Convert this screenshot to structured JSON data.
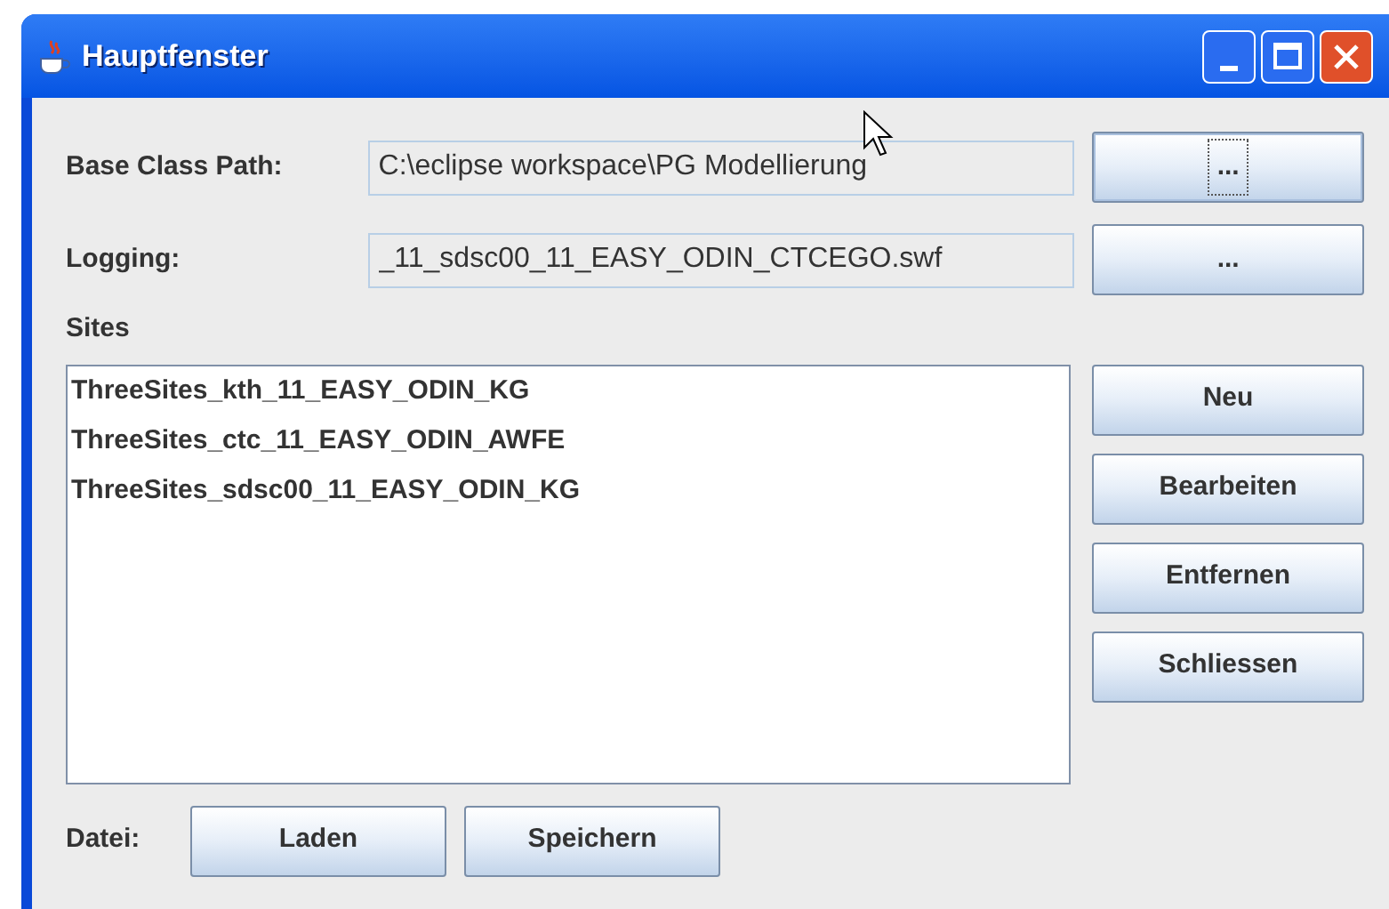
{
  "window": {
    "title": "Hauptfenster"
  },
  "fields": [
    {
      "label": "Base Class Path:",
      "value": "C:\\eclipse workspace\\PG Modellierung",
      "button": "...",
      "focused": true
    },
    {
      "label": "Logging:",
      "value": "_11_sdsc00_11_EASY_ODIN_CTCEGO.swf",
      "button": "...",
      "focused": false
    }
  ],
  "sites": {
    "label": "Sites",
    "items": [
      "ThreeSites_kth_11_EASY_ODIN_KG",
      "ThreeSites_ctc_11_EASY_ODIN_AWFE",
      "ThreeSites_sdsc00_11_EASY_ODIN_KG"
    ],
    "buttons": [
      "Neu",
      "Bearbeiten",
      "Entfernen",
      "Schliessen"
    ]
  },
  "file": {
    "label": "Datei:",
    "buttons": [
      "Laden",
      "Speichern"
    ]
  }
}
